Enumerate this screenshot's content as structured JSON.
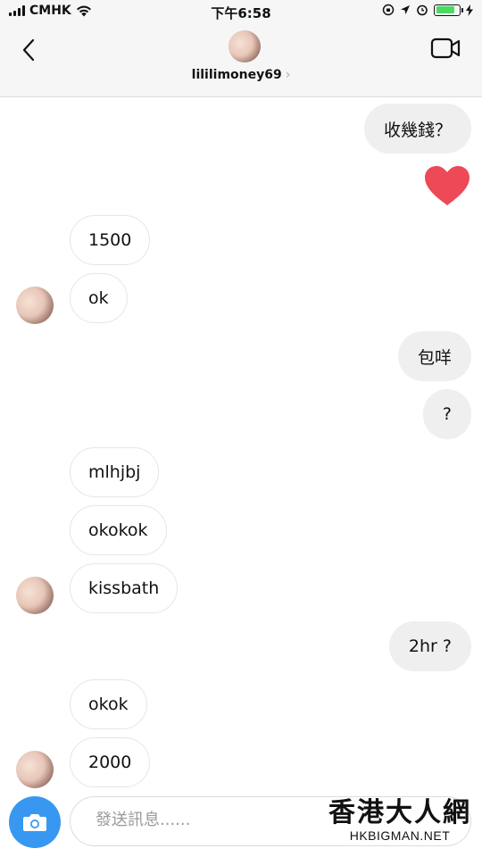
{
  "status_bar": {
    "carrier": "CMHK",
    "time": "下午6:58",
    "icons": [
      "signal-icon",
      "wifi-icon",
      "orientation-lock-icon",
      "location-icon",
      "alarm-icon",
      "battery-icon",
      "charging-icon"
    ],
    "battery_level": 0.8,
    "battery_color": "#4cd964"
  },
  "header": {
    "back_icon": "chevron-left-icon",
    "username": "lililimoney69",
    "username_chevron": "›",
    "video_icon": "video-call-icon"
  },
  "messages": [
    {
      "side": "out",
      "text": "收幾錢？"
    },
    {
      "side": "out",
      "type": "heart",
      "icon": "heart-icon",
      "color": "#ed4956"
    },
    {
      "side": "in",
      "text": "1500"
    },
    {
      "side": "in",
      "text": "ok"
    },
    {
      "side": "out",
      "text": "包咩"
    },
    {
      "side": "out",
      "text": "?"
    },
    {
      "side": "in",
      "text": "mlhjbj"
    },
    {
      "side": "in",
      "text": "okokok"
    },
    {
      "side": "in",
      "text": "kissbath"
    },
    {
      "side": "out",
      "text": "2hr ?"
    },
    {
      "side": "in",
      "text": "okok"
    },
    {
      "side": "in",
      "text": "2000"
    }
  ],
  "composer": {
    "camera_icon": "camera-icon",
    "placeholder": "發送訊息......",
    "accent": "#3897f0"
  },
  "watermark": {
    "title": "香港大人網",
    "subtitle": "HKBIGMAN.NET"
  }
}
